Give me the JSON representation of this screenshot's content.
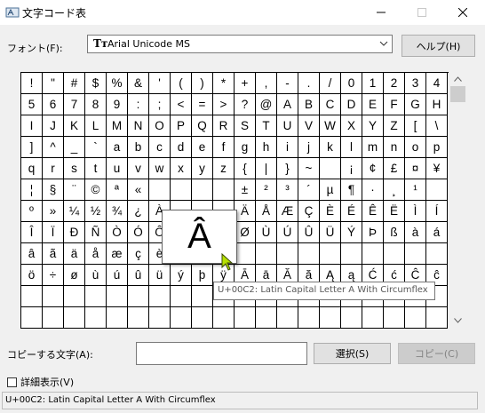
{
  "window": {
    "title": "文字コード表",
    "app_icon": "charmap-icon"
  },
  "font_row": {
    "label": "フォント(F):",
    "selected_font": "Arial Unicode MS",
    "font_type_icon": "truetype-icon",
    "help_label": "ヘルプ(H)"
  },
  "grid": {
    "rows": [
      [
        "!",
        "\"",
        "#",
        "$",
        "%",
        "&",
        "'",
        "(",
        ")",
        "*",
        "+",
        ",",
        "-",
        ".",
        "/",
        "0",
        "1",
        "2",
        "3",
        "4"
      ],
      [
        "5",
        "6",
        "7",
        "8",
        "9",
        ":",
        ";",
        "<",
        "=",
        ">",
        "?",
        "@",
        "A",
        "B",
        "C",
        "D",
        "E",
        "F",
        "G",
        "H"
      ],
      [
        "I",
        "J",
        "K",
        "L",
        "M",
        "N",
        "O",
        "P",
        "Q",
        "R",
        "S",
        "T",
        "U",
        "V",
        "W",
        "X",
        "Y",
        "Z",
        "[",
        "\\"
      ],
      [
        "]",
        "^",
        "_",
        "`",
        "a",
        "b",
        "c",
        "d",
        "e",
        "f",
        "g",
        "h",
        "i",
        "j",
        "k",
        "l",
        "m",
        "n",
        "o",
        "p"
      ],
      [
        "q",
        "r",
        "s",
        "t",
        "u",
        "v",
        "w",
        "x",
        "y",
        "z",
        "{",
        "|",
        "}",
        "~",
        "",
        "¡",
        "¢",
        "£",
        "¤",
        "¥"
      ],
      [
        "¦",
        "§",
        "¨",
        "©",
        "ª",
        "«",
        "",
        "",
        "",
        "",
        "±",
        "²",
        "³",
        "´",
        "µ",
        "¶",
        "·",
        "¸",
        "¹",
        ""
      ],
      [
        "º",
        "»",
        "¼",
        "½",
        "¾",
        "¿",
        "À",
        "",
        "",
        "",
        "Ä",
        "Å",
        "Æ",
        "Ç",
        "È",
        "É",
        "Ê",
        "Ë",
        "Ì",
        "Í"
      ],
      [
        "Î",
        "Ï",
        "Ð",
        "Ñ",
        "Ò",
        "Ó",
        "Ô",
        "Õ",
        "Ö",
        "×",
        "Ø",
        "Ù",
        "Ú",
        "Û",
        "Ü",
        "Ý",
        "Þ",
        "ß",
        "à",
        "á"
      ],
      [
        "â",
        "ã",
        "ä",
        "å",
        "æ",
        "ç",
        "è",
        "é",
        "ê",
        "ë",
        "",
        "",
        "",
        "",
        "",
        "",
        "",
        "",
        "",
        ""
      ],
      [
        "ö",
        "÷",
        "ø",
        "ù",
        "ú",
        "û",
        "ü",
        "ý",
        "þ",
        "ÿ",
        "Ā",
        "ā",
        "Ă",
        "ă",
        "Ą",
        "ą",
        "Ć",
        "ć",
        "Ĉ",
        "ĉ"
      ],
      [
        "",
        "",
        "",
        "",
        "",
        "",
        "",
        "",
        "",
        "",
        "",
        "",
        "",
        "",
        "",
        "",
        "",
        "",
        "",
        ""
      ],
      [
        "",
        "",
        "",
        "",
        "",
        "",
        "",
        "",
        "",
        "",
        "",
        "",
        "",
        "",
        "",
        "",
        "",
        "",
        "",
        ""
      ]
    ],
    "selected_char": "Â"
  },
  "tooltip": {
    "text": "U+00C2: Latin Capital Letter A With Circumflex"
  },
  "copy_row": {
    "label": "コピーする文字(A):",
    "value": "",
    "select_label": "選択(S)",
    "copy_label": "コピー(C)"
  },
  "detail_view": {
    "label": "詳細表示(V)",
    "checked": false
  },
  "status": {
    "text": "U+00C2: Latin Capital Letter A With Circumflex"
  }
}
